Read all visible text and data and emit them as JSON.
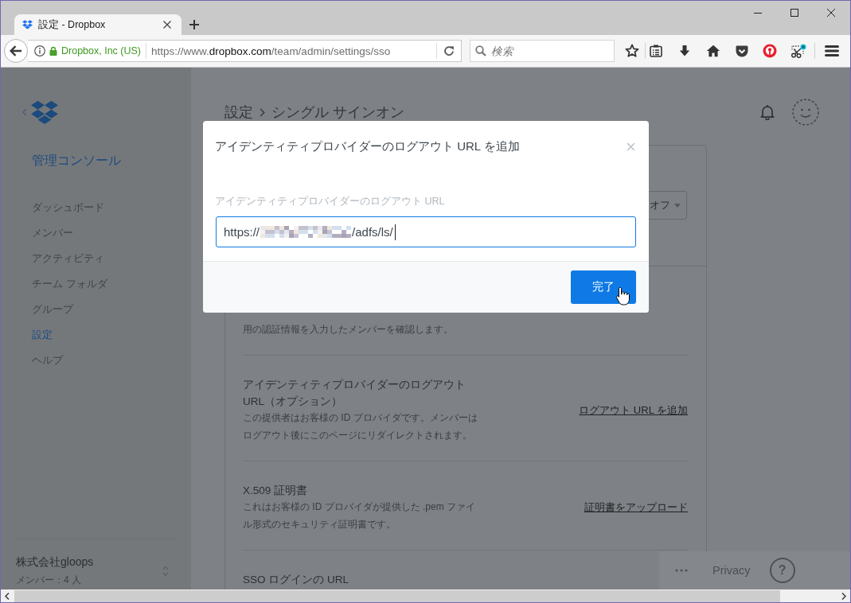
{
  "browser": {
    "tabs": [
      {
        "title": "設定 - Dropbox",
        "selected": true
      }
    ],
    "identity": "Dropbox, Inc (US)",
    "url": {
      "start": "https://www.",
      "domain": "dropbox.com",
      "path": "/team/admin/settings/sso"
    },
    "search": {
      "placeholder": "検索"
    }
  },
  "sidebar": {
    "title": "管理コンソール",
    "items": [
      {
        "label": "ダッシュボード",
        "selected": false
      },
      {
        "label": "メンバー",
        "selected": false
      },
      {
        "label": "アクティビティ",
        "selected": false
      },
      {
        "label": "チーム フォルダ",
        "selected": false
      },
      {
        "label": "グループ",
        "selected": false
      },
      {
        "label": "設定",
        "selected": true
      },
      {
        "label": "ヘルプ",
        "selected": false
      }
    ],
    "team": {
      "name": "株式会社gloops",
      "members": "メンバー：4 人"
    }
  },
  "header": {
    "breadcrumb": [
      "設定",
      "シングル サインオン"
    ]
  },
  "settings": {
    "dropdown": "オフ",
    "rows": [
      {
        "description": "用の認証情報を入力したメンバーを確認します。"
      },
      {
        "title": "アイデンティティプロバイダーのログアウト URL（オプション）",
        "description": "この提供者はお客様の ID プロバイダです。メンバーはログアウト後にこのページにリダイレクトされます。",
        "action": "ログアウト URL を追加"
      },
      {
        "title": "X.509 証明書",
        "description": "これはお客様の ID プロバイダが提供した .pem ファイル形式のセキュリティ証明書です。",
        "action": "証明書をアップロード"
      },
      {
        "title": "SSO ログインの URL"
      }
    ]
  },
  "footer": {
    "link": "Privacy",
    "help": "?"
  },
  "modal": {
    "title": "アイデンティティプロバイダーのログアウト URL を追加",
    "field": {
      "label": "アイデンティティプロバイダーのログアウト URL",
      "value_start": "https://",
      "redacted": true,
      "value_end": "/adfs/ls/",
      "focused": true
    },
    "button": "完了"
  }
}
